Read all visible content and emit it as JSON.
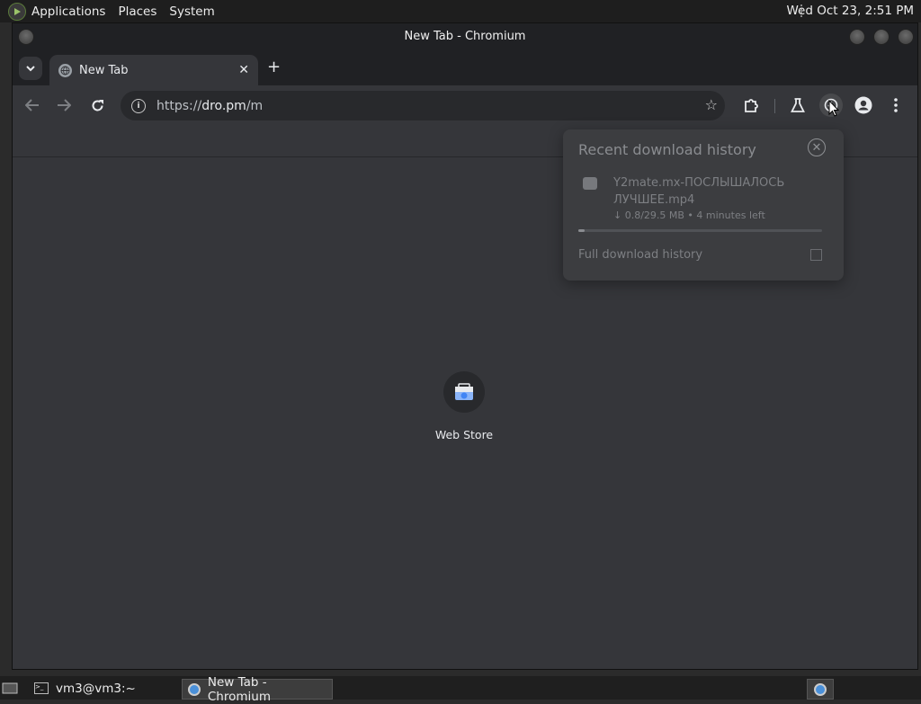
{
  "top_panel": {
    "menus": [
      "Applications",
      "Places",
      "System"
    ],
    "clock": "Wed Oct 23,  2:51 PM"
  },
  "window": {
    "title": "New Tab - Chromium"
  },
  "tabs": [
    {
      "label": "New Tab"
    }
  ],
  "omnibox": {
    "scheme": "https://",
    "host": "dro.pm",
    "path": "/m"
  },
  "shortcut": {
    "label": "Web Store"
  },
  "download_bubble": {
    "title": "Recent download history",
    "filename": "Y2mate.mx-ПОСЛЫШАЛОСЬ ЛУЧШЕЕ.mp4",
    "status": "↓ 0.8/29.5 MB • 4 minutes left",
    "progress": 0.027,
    "full_history_label": "Full download history"
  },
  "taskbar": {
    "items": [
      "vm3@vm3:~",
      "New Tab - Chromium"
    ]
  }
}
